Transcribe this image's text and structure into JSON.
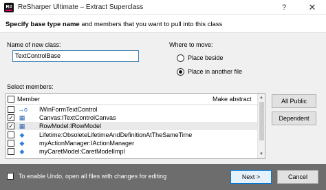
{
  "window": {
    "title": "ReSharper Ultimate – Extract Superclass",
    "logo_text": "R#",
    "help_label": "?",
    "close_label": "✕"
  },
  "header": {
    "bold_text": "Specify base type name",
    "rest_text": " and members that you want to pull into this class"
  },
  "class_name": {
    "label": "Name of new class:",
    "value": "TextControlBase"
  },
  "move": {
    "label": "Where to move:",
    "options": [
      {
        "label": "Place beside",
        "selected": false
      },
      {
        "label": "Place in another file",
        "selected": true
      }
    ]
  },
  "members": {
    "label": "Select members:",
    "columns": {
      "member": "Member",
      "abstract": "Make abstract"
    },
    "rows": [
      {
        "name": "IWinFormTextControl",
        "checked": false,
        "icon": "interface-icon",
        "icon_glyph": "→o",
        "icon_color": "#1e6fc4",
        "make_abstract": false,
        "show_abstract": false,
        "selected": false
      },
      {
        "name": "Canvas:ITextControlCanvas",
        "checked": true,
        "icon": "property-icon",
        "icon_glyph": "▦",
        "icon_color": "#2a5fb0",
        "make_abstract": true,
        "show_abstract": true,
        "selected": false
      },
      {
        "name": "RowModel:IRowModel",
        "checked": true,
        "icon": "property-icon",
        "icon_glyph": "▦",
        "icon_color": "#2a5fb0",
        "make_abstract": true,
        "show_abstract": true,
        "selected": true
      },
      {
        "name": "Lifetime:ObsoleteLifetimeAndDefinitionAtTheSameTime",
        "checked": false,
        "icon": "field-icon",
        "icon_glyph": "◆",
        "icon_color": "#2f7fd6",
        "make_abstract": false,
        "show_abstract": false,
        "selected": false
      },
      {
        "name": "myActionManager:IActionManager",
        "checked": false,
        "icon": "field-icon",
        "icon_glyph": "◆",
        "icon_color": "#2f7fd6",
        "make_abstract": false,
        "show_abstract": false,
        "selected": false
      },
      {
        "name": "myCaretModel:CaretModelImpl",
        "checked": false,
        "icon": "field-icon",
        "icon_glyph": "◆",
        "icon_color": "#2f7fd6",
        "make_abstract": false,
        "show_abstract": false,
        "selected": false
      }
    ]
  },
  "buttons": {
    "all_public": "All Public",
    "dependent": "Dependent",
    "next": "Next >",
    "cancel": "Cancel"
  },
  "footer": {
    "undo_text": "To enable Undo, open all files with changes for editing",
    "undo_checked": false
  },
  "colors": {
    "footer_bg": "#6d6d6d",
    "accent": "#0078d7"
  }
}
